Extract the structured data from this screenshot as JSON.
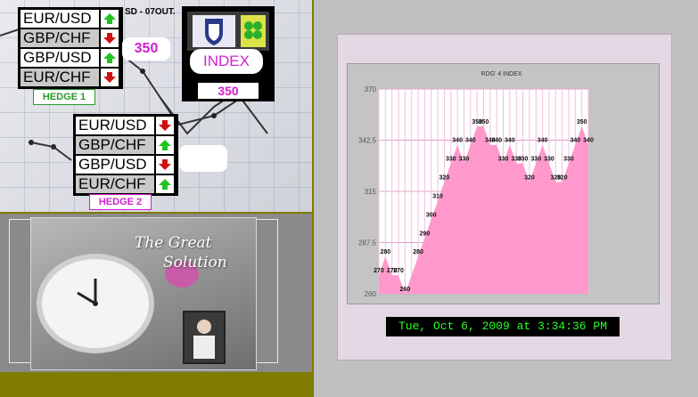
{
  "top_left_caption": "SD - 07OUT.",
  "hedge1": {
    "pairs": [
      {
        "name": "EUR/USD",
        "direction": "up"
      },
      {
        "name": "GBP/CHF",
        "direction": "down"
      },
      {
        "name": "GBP/USD",
        "direction": "up"
      },
      {
        "name": "EUR/CHF",
        "direction": "down"
      }
    ],
    "label": "HEDGE 1",
    "label_color": "#2a9a2a",
    "value": "350"
  },
  "hedge2": {
    "pairs": [
      {
        "name": "EUR/USD",
        "direction": "down"
      },
      {
        "name": "GBP/CHF",
        "direction": "up"
      },
      {
        "name": "GBP/USD",
        "direction": "down"
      },
      {
        "name": "EUR/CHF",
        "direction": "up"
      }
    ],
    "label": "HEDGE 2",
    "label_color": "#d020d0",
    "value": ""
  },
  "index_widget": {
    "label": "INDEX",
    "value": "350"
  },
  "photo_caption": {
    "line1": "The Great",
    "line2": "Solution"
  },
  "colors": {
    "up_arrow": "#22c222",
    "down_arrow": "#d01010",
    "area_fill": "#ff99cc",
    "value_text": "#d020d0",
    "timestamp_text": "#2aff2a"
  },
  "chart_data": {
    "type": "area",
    "title": "RDG' 4 INDEX",
    "xlabel": "",
    "ylabel": "",
    "ylim": [
      260,
      370
    ],
    "yticks": [
      "370",
      "342.5",
      "315",
      "287.5",
      "260"
    ],
    "grid": true,
    "values": [
      270,
      280,
      270,
      270,
      260,
      270,
      280,
      290,
      300,
      310,
      320,
      330,
      340,
      330,
      340,
      350,
      350,
      340,
      340,
      330,
      340,
      330,
      330,
      320,
      330,
      340,
      330,
      320,
      320,
      330,
      340,
      350,
      340
    ],
    "labels": [
      "270",
      "280",
      "270",
      "270",
      "260",
      "",
      "280",
      "290",
      "300",
      "310",
      "320",
      "330",
      "340",
      "330",
      "340",
      "350",
      "350",
      "340",
      "340",
      "330",
      "340",
      "330",
      "330",
      "320",
      "330",
      "340",
      "330",
      "320",
      "320",
      "330",
      "340",
      "350",
      "340"
    ]
  },
  "timestamp": "Tue, Oct 6, 2009 at 3:34:36 PM"
}
